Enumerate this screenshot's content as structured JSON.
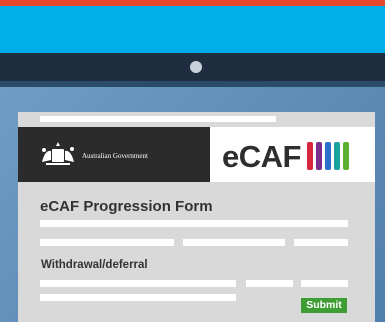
{
  "brand": {
    "government": "Australian Government",
    "logo_text": "eCAF",
    "logo_bar_colors": [
      "#d7263d",
      "#7b2d8e",
      "#2a6fc9",
      "#1aa39a",
      "#5bb031"
    ]
  },
  "form": {
    "title": "eCAF Progression Form",
    "section_title": "Withdrawal/deferral",
    "submit_label": "Submit"
  },
  "colors": {
    "accent_red": "#e5492e",
    "sky": "#00aee8",
    "submit_green": "#3e9e33",
    "device_dark": "#1e2e40"
  },
  "icons": {
    "crest": "australian-coat-of-arms",
    "camera": "camera-dot"
  }
}
